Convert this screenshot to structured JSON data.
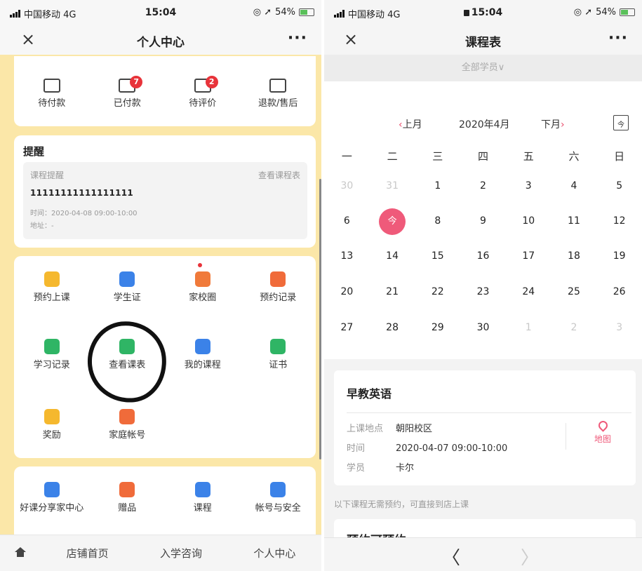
{
  "left": {
    "status": {
      "carrier": "中国移动 4G",
      "time": "15:04",
      "battery": "54%"
    },
    "nav": {
      "close": "×",
      "title": "个人中心",
      "more": "···"
    },
    "orders": [
      {
        "label": "待付款",
        "badge": ""
      },
      {
        "label": "已付款",
        "badge": "7"
      },
      {
        "label": "待评价",
        "badge": "2"
      },
      {
        "label": "退款/售后",
        "badge": ""
      }
    ],
    "reminder": {
      "title": "提醒",
      "heading": "课程提醒",
      "link": "查看课程表",
      "course": "11111111111111111",
      "time": "时间：2020-04-08 09:00-10:00",
      "address": "地址：-"
    },
    "functions": [
      {
        "label": "预约上课",
        "color": "#f5b82e"
      },
      {
        "label": "学生证",
        "color": "#3b82e8"
      },
      {
        "label": "家校圈",
        "color": "#f07a3a"
      },
      {
        "label": "预约记录",
        "color": "#f06b3a"
      },
      {
        "label": "学习记录",
        "color": "#2fb565"
      },
      {
        "label": "查看课表",
        "color": "#2fb565"
      },
      {
        "label": "我的课程",
        "color": "#3b82e8"
      },
      {
        "label": "证书",
        "color": "#2fb565"
      },
      {
        "label": "奖励",
        "color": "#f5b82e"
      },
      {
        "label": "家庭帐号",
        "color": "#f06b3a"
      }
    ],
    "others": [
      {
        "label": "好课分享家中心",
        "color": "#3b82e8"
      },
      {
        "label": "赠品",
        "color": "#f06b3a"
      },
      {
        "label": "课程",
        "color": "#3b82e8"
      },
      {
        "label": "帐号与安全",
        "color": "#3b82e8"
      }
    ],
    "tabbar": {
      "tabs": [
        "店铺首页",
        "入学咨询",
        "个人中心"
      ]
    }
  },
  "right": {
    "status": {
      "carrier": "中国移动 4G",
      "time": "15:04",
      "battery": "54%"
    },
    "nav": {
      "close": "×",
      "title": "课程表",
      "more": "···"
    },
    "filter": "全部学员∨",
    "calendar": {
      "prev": "上月",
      "month": "2020年4月",
      "next": "下月",
      "icon_text": "今",
      "weekdays": [
        "一",
        "二",
        "三",
        "四",
        "五",
        "六",
        "日"
      ],
      "weeks": [
        [
          {
            "d": "30",
            "m": true
          },
          {
            "d": "31",
            "m": true
          },
          {
            "d": "1"
          },
          {
            "d": "2"
          },
          {
            "d": "3"
          },
          {
            "d": "4"
          },
          {
            "d": "5"
          }
        ],
        [
          {
            "d": "6"
          },
          {
            "d": "今",
            "t": true
          },
          {
            "d": "8"
          },
          {
            "d": "9"
          },
          {
            "d": "10"
          },
          {
            "d": "11"
          },
          {
            "d": "12"
          }
        ],
        [
          {
            "d": "13"
          },
          {
            "d": "14"
          },
          {
            "d": "15"
          },
          {
            "d": "16"
          },
          {
            "d": "17"
          },
          {
            "d": "18"
          },
          {
            "d": "19"
          }
        ],
        [
          {
            "d": "20"
          },
          {
            "d": "21"
          },
          {
            "d": "22"
          },
          {
            "d": "23"
          },
          {
            "d": "24"
          },
          {
            "d": "25"
          },
          {
            "d": "26"
          }
        ],
        [
          {
            "d": "27"
          },
          {
            "d": "28"
          },
          {
            "d": "29"
          },
          {
            "d": "30"
          },
          {
            "d": "1",
            "m": true
          },
          {
            "d": "2",
            "m": true
          },
          {
            "d": "3",
            "m": true
          }
        ]
      ]
    },
    "course": {
      "title": "早教英语",
      "location_label": "上课地点",
      "location": "朝阳校区",
      "time_label": "时间",
      "time": "2020-04-07 09:00-10:00",
      "student_label": "学员",
      "student": "卡尔",
      "map": "地图"
    },
    "note": "以下课程无需预约，可直接到店上课",
    "next_section": "预约可预约",
    "bottom": {
      "back": "〈",
      "forward": "〉"
    }
  },
  "colors": {
    "page_bg": "#fbe7a8",
    "accent": "#ef5a7a",
    "badge": "#e8333a"
  }
}
